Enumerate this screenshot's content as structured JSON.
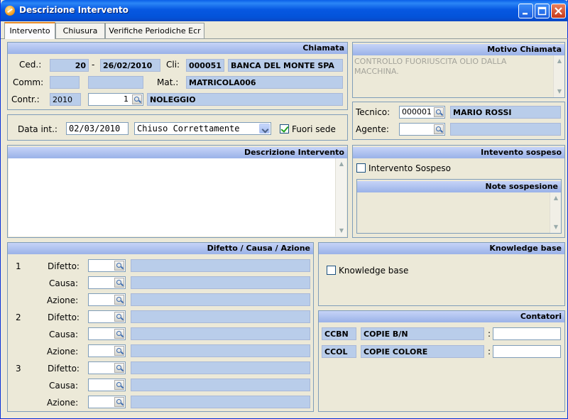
{
  "window": {
    "title": "Descrizione Intervento"
  },
  "tabs": [
    "Intervento",
    "Chiusura",
    "Verifiche Periodiche Ecr"
  ],
  "chiamata": {
    "header": "Chiamata",
    "ced_label": "Ced.:",
    "ced_num": "20",
    "dash": "-",
    "ced_date": "26/02/2010",
    "cli_label": "Cli:",
    "cli_code": "000051",
    "cli_name": "BANCA DEL MONTE SPA",
    "comm_label": "Comm:",
    "mat_label": "Mat.:",
    "mat_value": "MATRICOLA006",
    "contr_label": "Contr.:",
    "contr_year": "2010",
    "contr_num": "1",
    "contr_desc": "NOLEGGIO"
  },
  "motivo": {
    "header": "Motivo Chiamata",
    "text": "CONTROLLO FUORIUSCITA OLIO DALLA MACCHINA."
  },
  "tecnico": {
    "tecnico_label": "Tecnico:",
    "tecnico_code": "000001",
    "tecnico_name": "MARIO ROSSI",
    "agente_label": "Agente:"
  },
  "data_int": {
    "label": "Data int.:",
    "value": "02/03/2010",
    "status": "Chiuso Correttamente",
    "fuori_sede_label": "Fuori sede",
    "fuori_sede_checked": true
  },
  "descrizione": {
    "header": "Descrizione Intervento"
  },
  "sospeso": {
    "header": "Intevento sospeso",
    "checkbox_label": "Intervento Sospeso",
    "note_header": "Note sospesione"
  },
  "difetti": {
    "header": "Difetto / Causa / Azione",
    "groups": [
      {
        "num": "1",
        "rows": [
          "Difetto:",
          "Causa:",
          "Azione:"
        ]
      },
      {
        "num": "2",
        "rows": [
          "Difetto:",
          "Causa:",
          "Azione:"
        ]
      },
      {
        "num": "3",
        "rows": [
          "Difetto:",
          "Causa:",
          "Azione:"
        ]
      }
    ]
  },
  "knowledge": {
    "header": "Knowledge base",
    "checkbox_label": "Knowledge base"
  },
  "contatori": {
    "header": "Contatori",
    "rows": [
      {
        "code": "CCBN",
        "desc": "COPIE B/N",
        "sep": ":"
      },
      {
        "code": "CCOL",
        "desc": "COPIE COLORE",
        "sep": ":"
      }
    ]
  }
}
